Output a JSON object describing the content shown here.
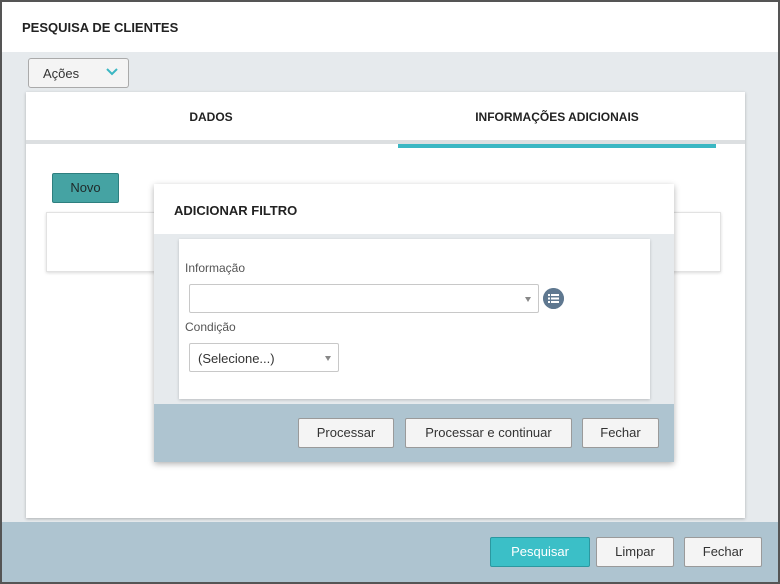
{
  "window": {
    "title": "PESQUISA DE CLIENTES"
  },
  "actions_menu": {
    "label": "Ações"
  },
  "tabs": [
    {
      "label": "DADOS",
      "active": false
    },
    {
      "label": "INFORMAÇÕES ADICIONAIS",
      "active": true
    }
  ],
  "new_button": {
    "label": "Novo"
  },
  "footer": {
    "search_label": "Pesquisar",
    "clear_label": "Limpar",
    "close_label": "Fechar"
  },
  "filter_dialog": {
    "title": "ADICIONAR FILTRO",
    "info_label": "Informação",
    "info_value": "",
    "condition_label": "Condição",
    "condition_value": "(Selecione...)",
    "process_label": "Processar",
    "process_continue_label": "Processar e continuar",
    "close_label": "Fechar"
  },
  "colors": {
    "accent": "#3bb7c3",
    "primary_button": "#3bbfc7",
    "new_button": "#45a3a3",
    "footer_bar": "#aec4d0",
    "list_icon": "#5f7890"
  },
  "icons": {
    "actions_chevron": "chevron-down-icon",
    "list": "list-icon",
    "dropdown_caret": "caret-down-icon"
  }
}
